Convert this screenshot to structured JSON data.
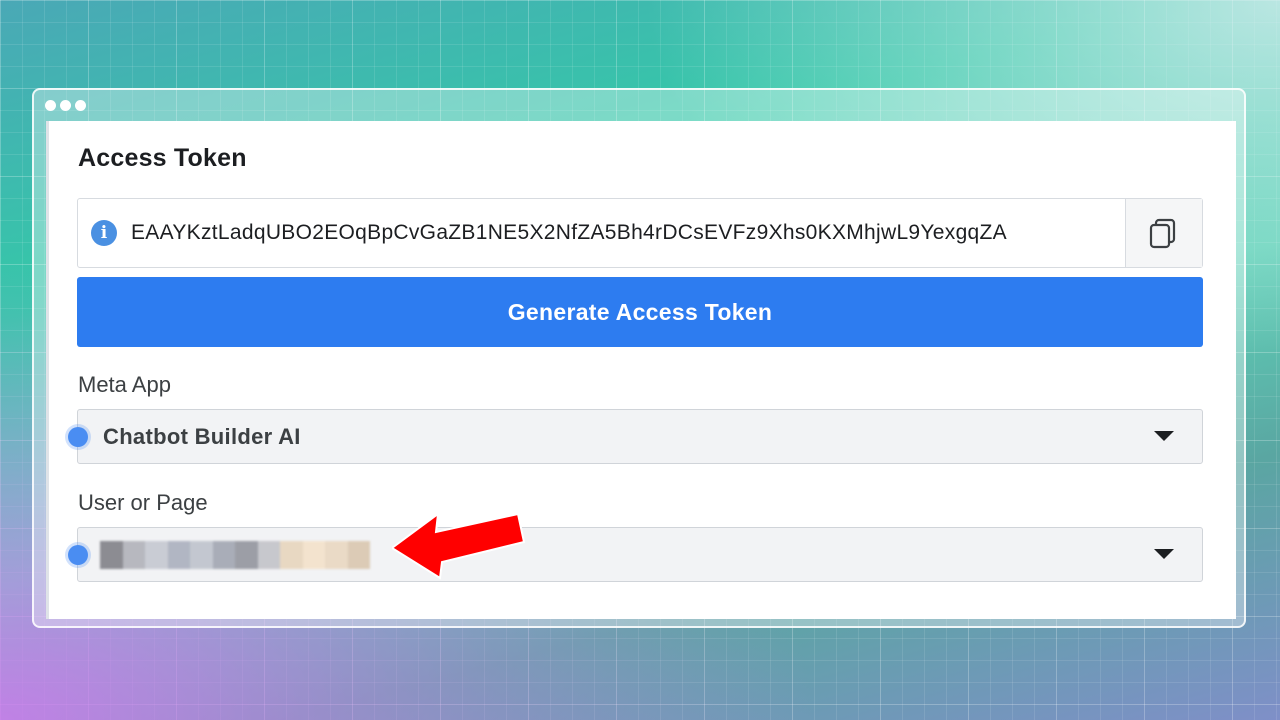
{
  "panel": {
    "title": "Access Token",
    "token_value": "EAAYKztLadqUBO2EOqBpCvGaZB1NE5X2NfZA5Bh4rDCsEVFz9Xhs0KXMhjwL9YexgqZA",
    "generate_button_label": "Generate Access Token",
    "meta_app": {
      "label": "Meta App",
      "selected": "Chatbot Builder AI"
    },
    "user_or_page": {
      "label": "User or Page",
      "selected_blurred": true
    }
  },
  "icons": {
    "info": "info-icon",
    "copy": "copy-icon",
    "dropdown": "chevron-down-icon",
    "annotation_arrow": "red-arrow"
  },
  "colors": {
    "primary": "#2d7cf0",
    "annotation": "#ff0000",
    "marker": "#4a8df2"
  }
}
